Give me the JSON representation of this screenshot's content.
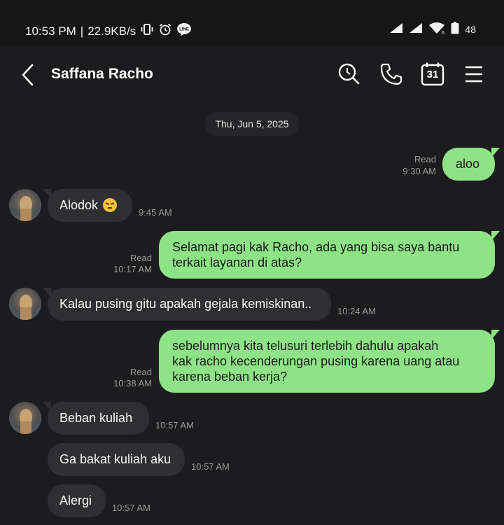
{
  "status_bar": {
    "time": "10:53 PM",
    "separator": "|",
    "speed": "22.9KB/s",
    "battery": "48",
    "icons": [
      "vibrate-icon",
      "alarm-icon",
      "line-app-icon",
      "signal-icon",
      "signal-icon",
      "wifi-icon",
      "battery-icon"
    ]
  },
  "header": {
    "title": "Saffana Racho",
    "calendar_day": "31",
    "icons": [
      "back-arrow-icon",
      "search-icon",
      "phone-icon",
      "calendar-icon",
      "menu-icon"
    ]
  },
  "date_separator": "Thu, Jun 5, 2025",
  "messages": [
    {
      "dir": "out",
      "lines": [
        "aloo"
      ],
      "status": "Read",
      "time": "9:30 AM"
    },
    {
      "dir": "in",
      "lines": [
        "Alodok"
      ],
      "emoji": "disappointed-face-emoji",
      "time": "9:45 AM"
    },
    {
      "dir": "out",
      "lines": [
        "Selamat pagi kak Racho, ada yang bisa saya bantu",
        "terkait layanan di atas?"
      ],
      "status": "Read",
      "time": "10:17 AM"
    },
    {
      "dir": "in",
      "lines": [
        "Kalau pusing gitu apakah gejala kemiskinan.."
      ],
      "time": "10:24 AM"
    },
    {
      "dir": "out",
      "lines": [
        "sebelumnya kita telusuri terlebih dahulu apakah",
        "kak racho kecenderungan pusing karena uang atau",
        "karena beban kerja?"
      ],
      "status": "Read",
      "time": "10:38 AM"
    },
    {
      "dir": "in",
      "lines": [
        "Beban kuliah"
      ],
      "time": "10:57 AM"
    },
    {
      "dir": "in",
      "lines": [
        "Ga bakat kuliah aku"
      ],
      "time": "10:57 AM"
    },
    {
      "dir": "in",
      "lines": [
        "Alergi"
      ],
      "time": "10:57 AM"
    }
  ],
  "colors": {
    "background": "#1c1c1e",
    "incoming_bubble": "#2f2f31",
    "outgoing_bubble": "#8fe387"
  }
}
